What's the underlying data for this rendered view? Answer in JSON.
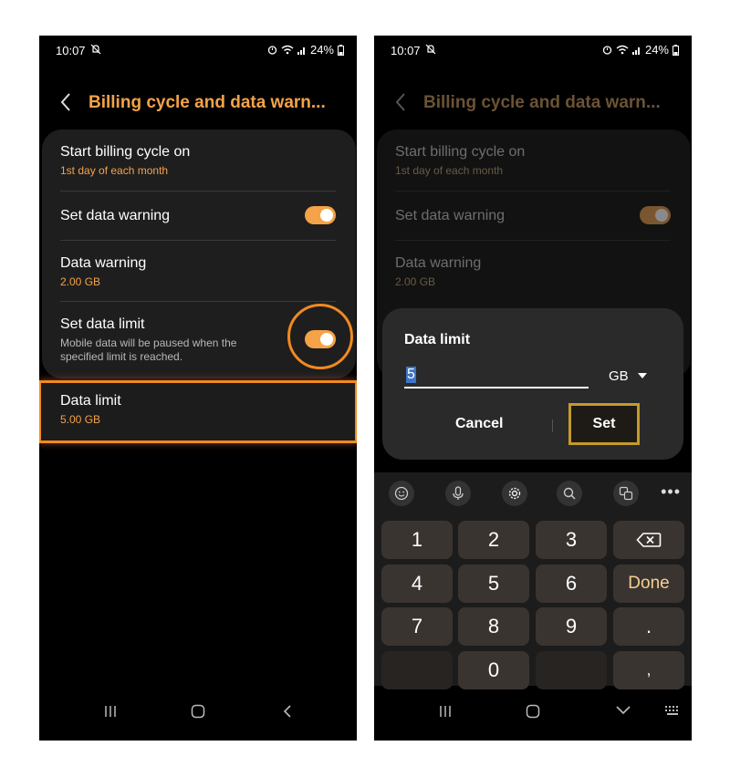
{
  "status": {
    "time": "10:07",
    "battery": "24%"
  },
  "header": {
    "title": "Billing cycle and data warn..."
  },
  "settings": {
    "billing_title": "Start billing cycle on",
    "billing_value": "1st day of each month",
    "warning_toggle_label": "Set data warning",
    "data_warning_title": "Data warning",
    "data_warning_value": "2.00 GB",
    "limit_toggle_label": "Set data limit",
    "limit_toggle_desc": "Mobile data will be paused when the specified limit is reached.",
    "data_limit_title": "Data limit",
    "data_limit_value": "5.00 GB"
  },
  "dialog": {
    "title": "Data limit",
    "input_value": "5",
    "unit": "GB",
    "cancel_label": "Cancel",
    "set_label": "Set"
  },
  "keyboard": {
    "more": "•••",
    "keys": [
      "1",
      "2",
      "3",
      "4",
      "5",
      "6",
      "Done",
      "7",
      "8",
      "9",
      ".",
      "0",
      ","
    ]
  },
  "colors": {
    "accent": "#f4a348",
    "highlight": "#f28a1e",
    "set_highlight": "#c49a2b"
  }
}
